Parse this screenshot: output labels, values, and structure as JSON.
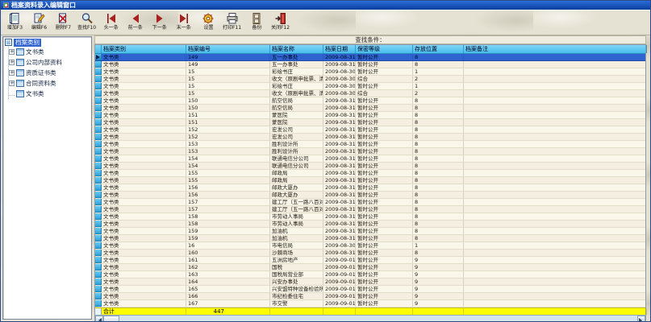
{
  "window": {
    "title": "档案资料录入编辑窗口"
  },
  "toolbar": {
    "buttons": [
      {
        "label": "增加F3",
        "icon": "add-record-icon"
      },
      {
        "label": "编辑F6",
        "icon": "edit-record-icon"
      },
      {
        "label": "删除F7",
        "icon": "delete-record-icon"
      },
      {
        "label": "查找F10",
        "icon": "find-record-icon"
      },
      {
        "label": "头一条",
        "icon": "first-record-icon"
      },
      {
        "label": "前一条",
        "icon": "prev-record-icon"
      },
      {
        "label": "下一条",
        "icon": "next-record-icon"
      },
      {
        "label": "末一条",
        "icon": "last-record-icon"
      },
      {
        "label": "设置",
        "icon": "settings-icon"
      },
      {
        "label": "打印F11",
        "icon": "print-icon"
      },
      {
        "label": "备份",
        "icon": "backup-icon"
      },
      {
        "label": "关闭F12",
        "icon": "close-exit-icon"
      }
    ]
  },
  "tree": {
    "root": "档案类别",
    "items": [
      {
        "label": "文书类",
        "expandable": true
      },
      {
        "label": "公司内部资料",
        "expandable": true
      },
      {
        "label": "资质证书类",
        "expandable": true
      },
      {
        "label": "合同资料类",
        "expandable": true
      },
      {
        "label": "文书类",
        "expandable": false
      }
    ]
  },
  "search_bar": {
    "label": "查找条件："
  },
  "grid": {
    "columns": [
      "档案类别",
      "档案编号",
      "档案名称",
      "档案日期",
      "保密等级",
      "存放位置",
      "档案备注"
    ],
    "selected_row_index": 0,
    "rows": [
      [
        "文书类",
        "149",
        "五一办事处",
        "2009-08-31",
        "暂时公开",
        "8",
        ""
      ],
      [
        "文书类",
        "149",
        "五一办事处",
        "2009-08-31",
        "暂时公开",
        "8",
        ""
      ],
      [
        "文书类",
        "15",
        "彩绘书庄",
        "2009-08-30",
        "暂时公开",
        "1",
        ""
      ],
      [
        "文书类",
        "15",
        "收文（原剧申批票、清数票）",
        "2009-08-30",
        "综合",
        "2",
        ""
      ],
      [
        "文书类",
        "15",
        "彩绘书庄",
        "2009-08-30",
        "暂时公开",
        "1",
        ""
      ],
      [
        "文书类",
        "15",
        "收文（原剧申批票、清数票）",
        "2009-08-30",
        "综合",
        "2",
        ""
      ],
      [
        "文书类",
        "150",
        "航空信局",
        "2009-08-31",
        "暂时公开",
        "8",
        ""
      ],
      [
        "文书类",
        "150",
        "航空信局",
        "2009-08-31",
        "暂时公开",
        "8",
        ""
      ],
      [
        "文书类",
        "151",
        "蒙医院",
        "2009-08-31",
        "暂时公开",
        "8",
        ""
      ],
      [
        "文书类",
        "151",
        "蒙医院",
        "2009-08-31",
        "暂时公开",
        "8",
        ""
      ],
      [
        "文书类",
        "152",
        "宏发公司",
        "2009-08-31",
        "暂时公开",
        "8",
        ""
      ],
      [
        "文书类",
        "152",
        "宏发公司",
        "2009-08-31",
        "暂时公开",
        "8",
        ""
      ],
      [
        "文书类",
        "153",
        "胜利设计所",
        "2009-08-31",
        "暂时公开",
        "8",
        ""
      ],
      [
        "文书类",
        "153",
        "胜利设计所",
        "2009-08-31",
        "暂时公开",
        "8",
        ""
      ],
      [
        "文书类",
        "154",
        "联通电信分公司",
        "2009-08-31",
        "暂时公开",
        "8",
        ""
      ],
      [
        "文书类",
        "154",
        "联通电信分公司",
        "2009-08-31",
        "暂时公开",
        "8",
        ""
      ],
      [
        "文书类",
        "155",
        "邮政局",
        "2009-08-31",
        "暂时公开",
        "8",
        ""
      ],
      [
        "文书类",
        "155",
        "邮政局",
        "2009-08-31",
        "暂时公开",
        "8",
        ""
      ],
      [
        "文书类",
        "156",
        "邮政大厦办",
        "2009-08-31",
        "暂时公开",
        "8",
        ""
      ],
      [
        "文书类",
        "156",
        "邮政大厦办",
        "2009-08-31",
        "暂时公开",
        "8",
        ""
      ],
      [
        "文书类",
        "157",
        "建工厅（五一路八百对过）",
        "2009-08-31",
        "暂时公开",
        "8",
        ""
      ],
      [
        "文书类",
        "157",
        "建工厅（五一路八百对过）",
        "2009-08-31",
        "暂时公开",
        "8",
        ""
      ],
      [
        "文书类",
        "158",
        "市劳动人事局",
        "2009-08-31",
        "暂时公开",
        "8",
        ""
      ],
      [
        "文书类",
        "158",
        "市劳动人事局",
        "2009-08-31",
        "暂时公开",
        "8",
        ""
      ],
      [
        "文书类",
        "159",
        "加油机",
        "2009-08-31",
        "暂时公开",
        "8",
        ""
      ],
      [
        "文书类",
        "159",
        "加油机",
        "2009-08-31",
        "暂时公开",
        "8",
        ""
      ],
      [
        "文书类",
        "16",
        "市电信局",
        "2009-08-30",
        "暂时公开",
        "1",
        ""
      ],
      [
        "文书类",
        "160",
        "沙棘商场",
        "2009-08-31",
        "暂时公开",
        "8",
        ""
      ],
      [
        "文书类",
        "161",
        "五洲房地产",
        "2009-09-01",
        "暂时公开",
        "9",
        ""
      ],
      [
        "文书类",
        "162",
        "国税",
        "2009-09-01",
        "暂时公开",
        "9",
        ""
      ],
      [
        "文书类",
        "163",
        "国税局营业部",
        "2009-09-01",
        "暂时公开",
        "9",
        ""
      ],
      [
        "文书类",
        "164",
        "兴安办事处",
        "2009-09-01",
        "暂时公开",
        "9",
        ""
      ],
      [
        "文书类",
        "165",
        "兴安盟特种设备检验所",
        "2009-09-01",
        "暂时公开",
        "9",
        ""
      ],
      [
        "文书类",
        "166",
        "市纪检委住宅",
        "2009-09-01",
        "暂时公开",
        "9",
        ""
      ],
      [
        "文书类",
        "167",
        "市交警",
        "2009-09-01",
        "暂时公开",
        "9",
        ""
      ]
    ],
    "total_row": {
      "label": "合计",
      "value": "447"
    }
  },
  "colors": {
    "titlebar_blue": "#2a6cd8",
    "header_blue": "#49bcec",
    "selected_row_blue": "#2f63d0",
    "total_row_yellow": "#ffff00",
    "toolbar_bg": "#e6e2d3"
  }
}
